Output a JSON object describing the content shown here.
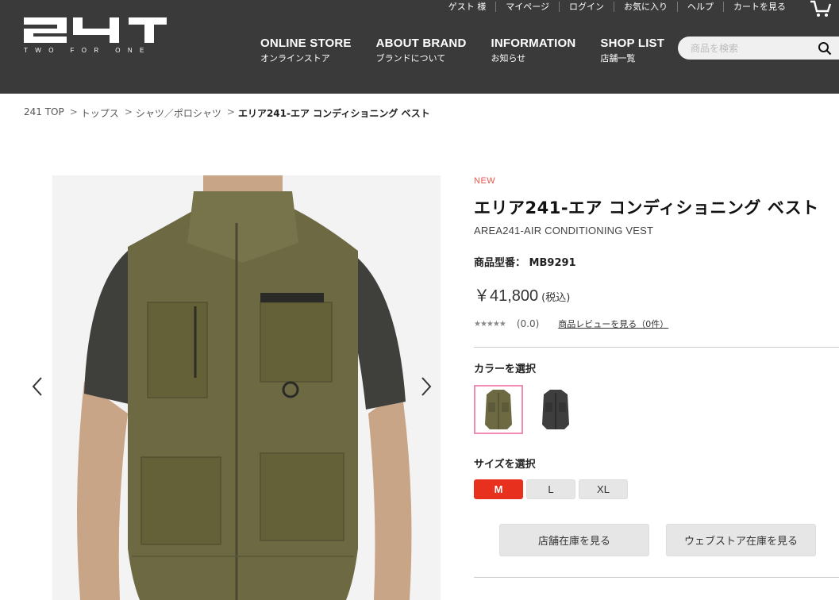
{
  "header": {
    "logo_text": "TWO FOR ONE",
    "utility": [
      "ゲスト 様",
      "マイページ",
      "ログイン",
      "お気に入り",
      "ヘルプ",
      "カートを見る"
    ],
    "nav": [
      {
        "en": "ONLINE STORE",
        "ja": "オンラインストア"
      },
      {
        "en": "ABOUT BRAND",
        "ja": "ブランドについて"
      },
      {
        "en": "INFORMATION",
        "ja": "お知らせ"
      },
      {
        "en": "SHOP LIST",
        "ja": "店舗一覧"
      }
    ],
    "search_placeholder": "商品を検索"
  },
  "breadcrumb": [
    "241 TOP",
    "トップス",
    "シャツ／ポロシャツ",
    "エリア241-エア コンディショニング ベスト"
  ],
  "product": {
    "new_label": "NEW",
    "title": "エリア241-エア コンディショニング ベスト",
    "subtitle": "AREA241-AIR CONDITIONING VEST",
    "model_label": "商品型番：",
    "model_value": "MB9291",
    "price": "￥41,800",
    "price_tax": "(税込)",
    "rating_stars": "★★★★★",
    "rating_score": "(0.0)",
    "review_link": "商品レビューを見る（0件）",
    "color_label": "カラーを選択",
    "size_label": "サイズを選択",
    "sizes": [
      "M",
      "L",
      "XL"
    ],
    "selected_size": "M",
    "store_stock_button": "店舗在庫を見る",
    "web_stock_button": "ウェブストア在庫を見る",
    "colors": {
      "olive": "#6d6a43",
      "charcoal": "#3e3e3e"
    }
  },
  "accent": {
    "header_bg": "#3a3a3a",
    "new_color": "#e8574e",
    "size_selected": "#e8301f",
    "swatch_border": "#f08bb4"
  }
}
